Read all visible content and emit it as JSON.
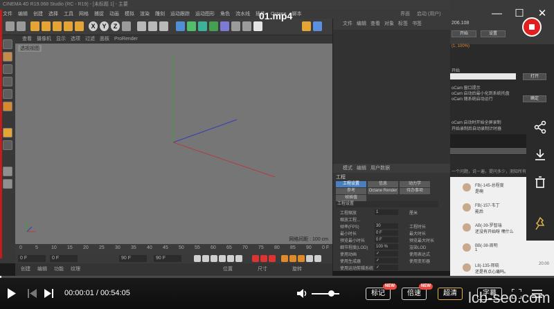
{
  "video": {
    "title": "01.mp4",
    "current_time": "00:00:01",
    "separator": "/",
    "duration": "00:54:05",
    "progress_fraction": 0.0003
  },
  "c4d": {
    "window_title": "CINEMA 4D R19.068 Studio (RC - R19) - [未标题 1] - 主要",
    "menu": [
      "文件",
      "编辑",
      "创建",
      "选择",
      "工具",
      "网格",
      "捕捉",
      "动画",
      "模拟",
      "渲染",
      "雕刻",
      "运动跟踪",
      "运动图形",
      "角色",
      "流水线",
      "插件",
      "Octane",
      "脚本"
    ],
    "layout_label": "界面",
    "layout_value": "启动 (用户)",
    "viewport_menu": [
      "查看",
      "摄像机",
      "显示",
      "选项",
      "过滤",
      "面板",
      "ProRender"
    ],
    "viewport_label": "透视视图",
    "grid_spacing": "网格间距 : 100 cm",
    "timeline_ticks": [
      "0",
      "5",
      "10",
      "15",
      "20",
      "25",
      "30",
      "35",
      "40",
      "45",
      "50",
      "55",
      "60",
      "65",
      "70",
      "75",
      "80",
      "85",
      "90",
      "0 F"
    ],
    "frame_start": "0 F",
    "frame_current": "0 F",
    "frame_end": "90 F",
    "frame_end2": "90 F",
    "object_manager_menu": [
      "文件",
      "编辑",
      "查看",
      "对象",
      "标签",
      "书签"
    ],
    "attr_menu": [
      "模式",
      "编辑",
      "用户数据"
    ],
    "attr_title": "工程",
    "attr_tabs": [
      "工程设置",
      "信息",
      "动力学",
      "参考",
      "Octane Render",
      "待办事项",
      "帧插值"
    ],
    "attr_section": "工程设置",
    "attr_rows": [
      {
        "label": "工程缩放",
        "value": "1",
        "unit": "厘米"
      },
      {
        "label": "缩放工程...",
        "value": "",
        "unit": ""
      },
      {
        "label": "帧率(FPS)",
        "value": "30",
        "unit": "工程时长"
      },
      {
        "label": "最小时长",
        "value": "0 F",
        "unit": "最大时长"
      },
      {
        "label": "预览最小时长",
        "value": "0 F",
        "unit": "预览最大时长"
      },
      {
        "label": "细节程度(LOD)",
        "value": "100 %",
        "unit": "渲染LOD"
      },
      {
        "label": "使用动画",
        "value": "✓",
        "unit": "使用表达式"
      },
      {
        "label": "使用生成器",
        "value": "✓",
        "unit": "使用变形器"
      },
      {
        "label": "使用运动剪辑系统",
        "value": "✓",
        "unit": ""
      }
    ],
    "coord_labels": [
      "位置",
      "尺寸",
      "旋转"
    ],
    "bottom_menu": [
      "创建",
      "编辑",
      "功能",
      "纹理"
    ]
  },
  "side_panel": {
    "id_text": "206.108",
    "button_start": "开始",
    "button_settings": "设置",
    "status_line": "(1, 100%)",
    "label_start": "开始",
    "path_button": "打开",
    "lines": [
      "oCam 窗口提示",
      "oCam 启动后最小化到系统托盘",
      "oCam 随系统启动运行",
      "oCam 启动时开始全屏录制",
      "开始录制后自动录制计时器"
    ],
    "confirm": "确定",
    "hint": "一个问题，说一遍，提问多少，测知所有知识。",
    "chats": [
      {
        "name": "FB(-145-总程度",
        "msg": "是啊",
        "time": ""
      },
      {
        "name": "FB(-157-韦丁",
        "msg": "能后",
        "time": "19:58"
      },
      {
        "name": "AB(-39-罗智瑞",
        "msg": "还没有开始呀 嘿什么",
        "time": "19:58"
      },
      {
        "name": "BB(-38-周明",
        "msg": "1",
        "time": ""
      },
      {
        "name": "L8(-135-邢晓",
        "msg": "还是有点心痛吗。",
        "time": "20:00"
      }
    ]
  },
  "controls": {
    "danmaku_label": "标记",
    "speed_label": "倍速",
    "quality_label": "超清",
    "subtitle_label": "字幕",
    "new_badge": "NEW",
    "new_badge2": "NEW"
  },
  "watermark": "lcb-seo.com",
  "colors": {
    "accent_red": "#e02020",
    "quality_border": "#e0b54a",
    "viewport_bg": "#767676"
  }
}
